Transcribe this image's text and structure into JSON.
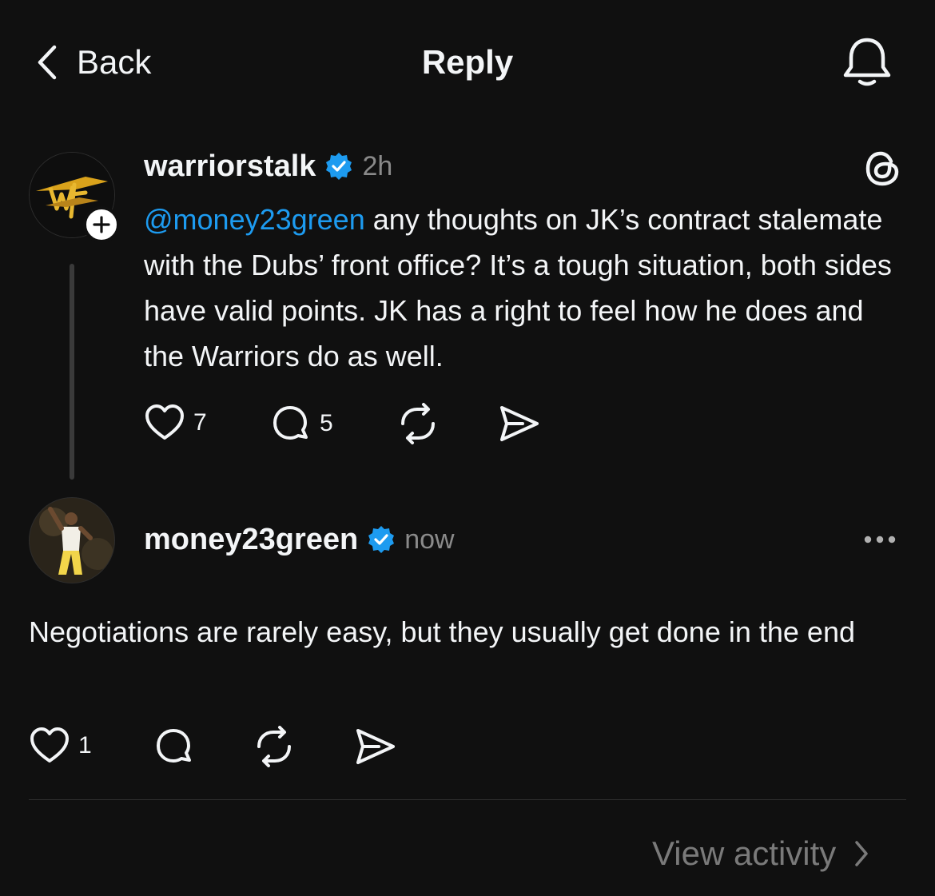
{
  "header": {
    "back_label": "Back",
    "title": "Reply",
    "back_icon": "chevron-left-icon",
    "bell_icon": "bell-icon"
  },
  "post": {
    "username": "warriorstalk",
    "verified": true,
    "time": "2h",
    "mention": "@money23green",
    "text": " any thoughts on JK’s contract stalemate with the Dubs’ front office? It’s a tough situation, both sides have valid points. JK has a right to feel how he does and the Warriors do as well.",
    "likes": "7",
    "replies": "5",
    "app_icon": "threads-icon"
  },
  "reply": {
    "username": "money23green",
    "verified": true,
    "time": "now",
    "text": "Negotiations are rarely easy, but they usually get done in the end",
    "likes": "1",
    "more_icon": "more-icon"
  },
  "footer": {
    "view_activity_label": "View activity"
  },
  "colors": {
    "background": "#101010",
    "text": "#f3f5f7",
    "muted": "#8a8a8a",
    "mention": "#1d9bf0",
    "verified": "#1d9bf0"
  }
}
